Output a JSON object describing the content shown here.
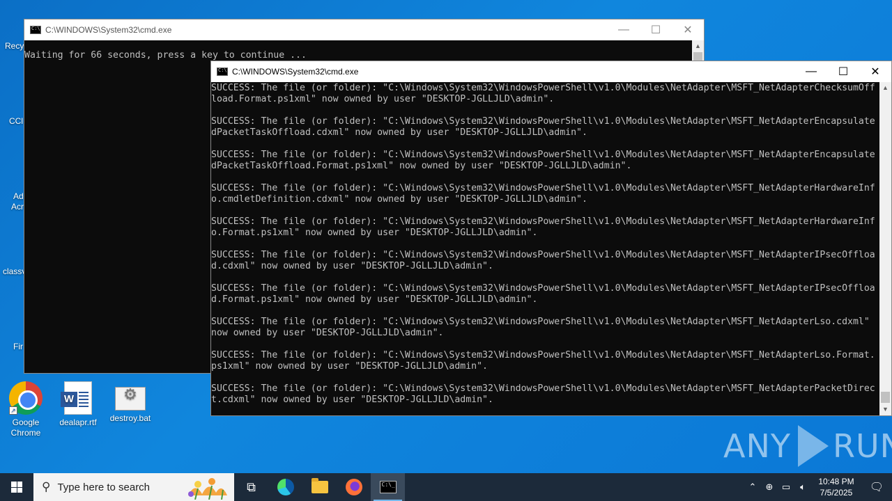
{
  "desktop": {
    "icons": [
      {
        "label": "Google Chrome"
      },
      {
        "label": "dealapr.rtf"
      },
      {
        "label": "destroy.bat"
      }
    ],
    "partial_labels": [
      "Recy",
      "CCl",
      "Ad",
      "Acr",
      "classv",
      "Fir"
    ]
  },
  "window_back": {
    "title": "C:\\WINDOWS\\System32\\cmd.exe",
    "content": "Waiting for 66 seconds, press a key to continue ..."
  },
  "window_front": {
    "title": "C:\\WINDOWS\\System32\\cmd.exe",
    "lines": [
      "SUCCESS: The file (or folder): \"C:\\Windows\\System32\\WindowsPowerShell\\v1.0\\Modules\\NetAdapter\\MSFT_NetAdapterChecksumOff",
      "load.Format.ps1xml\" now owned by user \"DESKTOP-JGLLJLD\\admin\".",
      "",
      "SUCCESS: The file (or folder): \"C:\\Windows\\System32\\WindowsPowerShell\\v1.0\\Modules\\NetAdapter\\MSFT_NetAdapterEncapsulate",
      "dPacketTaskOffload.cdxml\" now owned by user \"DESKTOP-JGLLJLD\\admin\".",
      "",
      "SUCCESS: The file (or folder): \"C:\\Windows\\System32\\WindowsPowerShell\\v1.0\\Modules\\NetAdapter\\MSFT_NetAdapterEncapsulate",
      "dPacketTaskOffload.Format.ps1xml\" now owned by user \"DESKTOP-JGLLJLD\\admin\".",
      "",
      "SUCCESS: The file (or folder): \"C:\\Windows\\System32\\WindowsPowerShell\\v1.0\\Modules\\NetAdapter\\MSFT_NetAdapterHardwareInf",
      "o.cmdletDefinition.cdxml\" now owned by user \"DESKTOP-JGLLJLD\\admin\".",
      "",
      "SUCCESS: The file (or folder): \"C:\\Windows\\System32\\WindowsPowerShell\\v1.0\\Modules\\NetAdapter\\MSFT_NetAdapterHardwareInf",
      "o.Format.ps1xml\" now owned by user \"DESKTOP-JGLLJLD\\admin\".",
      "",
      "SUCCESS: The file (or folder): \"C:\\Windows\\System32\\WindowsPowerShell\\v1.0\\Modules\\NetAdapter\\MSFT_NetAdapterIPsecOffloa",
      "d.cdxml\" now owned by user \"DESKTOP-JGLLJLD\\admin\".",
      "",
      "SUCCESS: The file (or folder): \"C:\\Windows\\System32\\WindowsPowerShell\\v1.0\\Modules\\NetAdapter\\MSFT_NetAdapterIPsecOffloa",
      "d.Format.ps1xml\" now owned by user \"DESKTOP-JGLLJLD\\admin\".",
      "",
      "SUCCESS: The file (or folder): \"C:\\Windows\\System32\\WindowsPowerShell\\v1.0\\Modules\\NetAdapter\\MSFT_NetAdapterLso.cdxml\"",
      "now owned by user \"DESKTOP-JGLLJLD\\admin\".",
      "",
      "SUCCESS: The file (or folder): \"C:\\Windows\\System32\\WindowsPowerShell\\v1.0\\Modules\\NetAdapter\\MSFT_NetAdapterLso.Format.",
      "ps1xml\" now owned by user \"DESKTOP-JGLLJLD\\admin\".",
      "",
      "SUCCESS: The file (or folder): \"C:\\Windows\\System32\\WindowsPowerShell\\v1.0\\Modules\\NetAdapter\\MSFT_NetAdapterPacketDirec",
      "t.cdxml\" now owned by user \"DESKTOP-JGLLJLD\\admin\"."
    ]
  },
  "watermark": {
    "left": "ANY",
    "right": "RUN"
  },
  "taskbar": {
    "search_placeholder": "Type here to search",
    "time": "10:48 PM",
    "date": "7/5/2025"
  }
}
